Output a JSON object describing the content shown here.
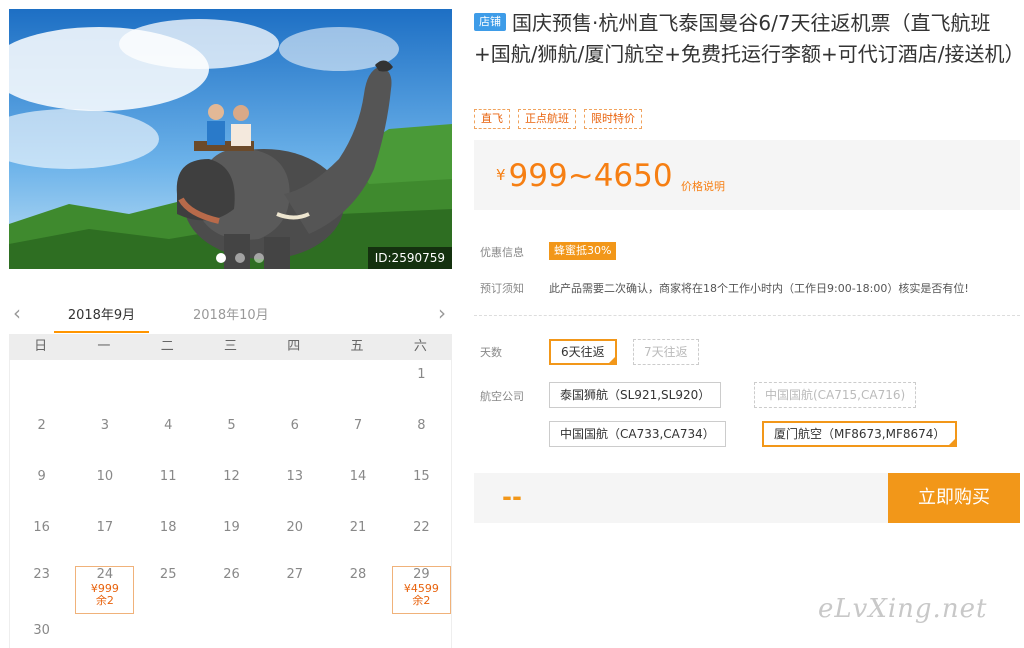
{
  "hero": {
    "image_id": "ID:2590759",
    "carousel_dots": 3,
    "active_dot": 0
  },
  "calendar": {
    "prev_arrow": "chevron-left-icon",
    "next_arrow": "chevron-right-icon",
    "months": [
      "2018年9月",
      "2018年10月"
    ],
    "active_month": 0,
    "weekdays": [
      "日",
      "一",
      "二",
      "三",
      "四",
      "五",
      "六"
    ],
    "first_weekday": 6,
    "visible_days": 30,
    "available": {
      "24": {
        "price": "¥999",
        "remain": "余2"
      },
      "29": {
        "price": "¥4599",
        "remain": "余2"
      }
    }
  },
  "product": {
    "shop_tag": "店铺",
    "title": "国庆预售·杭州直飞泰国曼谷6/7天往返机票（直飞航班+国航/狮航/厦门航空+免费托运行李额+可代订酒店/接送机）",
    "tags": [
      "直飞",
      "正点航班",
      "限时特价"
    ],
    "price_symbol": "¥",
    "price_range": "999~4650",
    "price_explain": "价格说明"
  },
  "info": {
    "promo_label": "优惠信息",
    "promo_badge": "蜂蜜抵30%",
    "notice_label": "预订须知",
    "notice_text": "此产品需要二次确认，商家将在18个工作小时内（工作日9:00-18:00）核实是否有位!"
  },
  "options": {
    "days_label": "天数",
    "days": [
      {
        "label": "6天往返",
        "state": "selected"
      },
      {
        "label": "7天往返",
        "state": "disabled"
      }
    ],
    "airline_label": "航空公司",
    "airlines": [
      {
        "label": "泰国狮航（SL921,SL920）",
        "state": "normal"
      },
      {
        "label": "中国国航(CA715,CA716)",
        "state": "disabled"
      },
      {
        "label": "中国国航（CA733,CA734）",
        "state": "normal"
      },
      {
        "label": "厦门航空（MF8673,MF8674）",
        "state": "selected"
      }
    ]
  },
  "purchase": {
    "total": "--",
    "buy_label": "立即购买"
  },
  "watermark": "eLvXing.net",
  "colors": {
    "accent": "#f29719",
    "price": "#f67f13",
    "shop_tag": "#3e9ce8"
  }
}
